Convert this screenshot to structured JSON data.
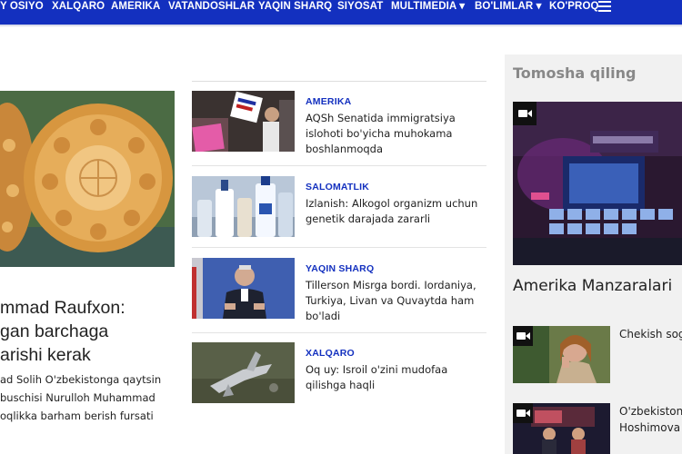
{
  "nav": {
    "items": [
      "Y OSIYO",
      "XALQARO",
      "AMERIKA",
      "VATANDOSHLAR",
      "YAQIN SHARQ",
      "SIYOSAT",
      "MULTIMEDIA ▾",
      "BO'LIMLAR ▾",
      "KO'PROQ"
    ],
    "menu_icon": "hamburger-menu-icon"
  },
  "colors": {
    "nav_bg": "#1330bf",
    "category": "#1330bf",
    "sidebar_bg": "#f1f1f1"
  },
  "hero": {
    "image": "bread-loaves-photo",
    "title_lines": [
      "mmad Raufxon:",
      "gan barchaga",
      "arishi kerak"
    ],
    "summary_lines": [
      "ad Solih O'zbekistonga qaytsin",
      "buschisi Nurulloh Muhammad",
      "oqlikka barham berish fursati"
    ]
  },
  "articles": [
    {
      "category": "AMERIKA",
      "headline": "AQSh Senatida immigratsiya islohoti bo'yicha muhokama boshlanmoqda",
      "image": "protest-support-daca-photo"
    },
    {
      "category": "SALOMATLIK",
      "headline": "Izlanish: Alkogol organizm uchun genetik darajada zararli",
      "image": "alcohol-bottles-photo"
    },
    {
      "category": "YAQIN SHARQ",
      "headline": "Tillerson Misrga bordi. Iordaniya, Turkiya, Livan va Quvaytda ham bo'ladi",
      "image": "tillerson-podium-photo"
    },
    {
      "category": "XALQARO",
      "headline": "Oq uy: Isroil o'zini mudofaa qilishga haqli",
      "image": "aircraft-wreckage-photo"
    }
  ],
  "sidebar": {
    "heading": "Tomosha qiling",
    "featured": {
      "title": "Amerika Manzaralari",
      "image": "tv-studio-photo"
    },
    "videos": [
      {
        "title_lines": [
          "Chekish sog'"
        ],
        "image": "woman-smoking-photo"
      },
      {
        "title_lines": [
          "O'zbekiston-",
          "Hoshimova"
        ],
        "image": "tv-studio-interview-photo"
      }
    ],
    "video_icon": "video-camera-icon"
  }
}
